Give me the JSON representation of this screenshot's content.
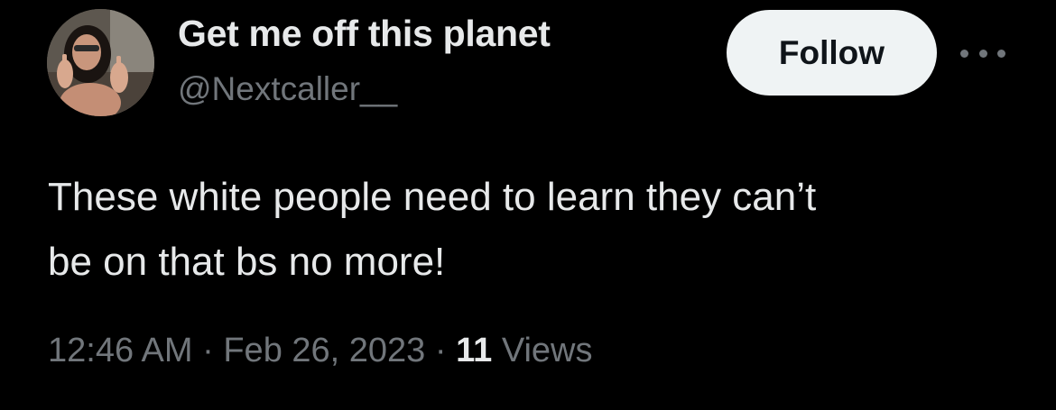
{
  "user": {
    "display_name": "Get me off this planet",
    "handle": "@Nextcaller__"
  },
  "actions": {
    "follow_label": "Follow",
    "more_icon": "more-horizontal-icon"
  },
  "tweet": {
    "text_line1": "These white people need to learn they can’t",
    "text_line2": "be on that bs no more!"
  },
  "meta": {
    "time": "12:46 AM",
    "separator": " · ",
    "date": "Feb 26, 2023",
    "views_count": "11",
    "views_label": " Views"
  },
  "colors": {
    "background": "#000000",
    "primary_text": "#e7e9ea",
    "secondary_text": "#71767b",
    "follow_button_bg": "#eff3f4"
  }
}
